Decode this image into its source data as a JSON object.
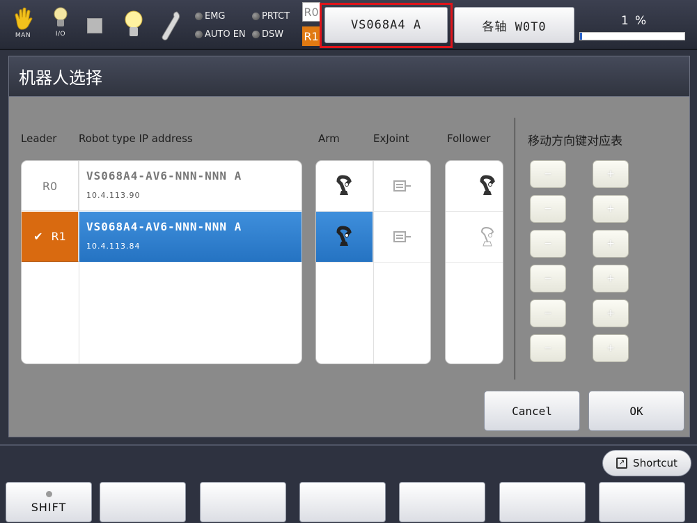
{
  "topbar": {
    "mode_label": "MAN",
    "io_label": "I/O",
    "indicators": [
      "EMG",
      "PRTCT",
      "AUTO EN",
      "DSW"
    ],
    "robot_labels": [
      "R0",
      "R1"
    ],
    "robot_button": "VS068A4 A",
    "axis_button": "各轴 W0T0",
    "speed_text": "1 %",
    "speed_percent": 1
  },
  "dialog": {
    "title": "机器人选择",
    "headers": {
      "leader": "Leader",
      "robot_type": "Robot type  IP address",
      "arm": "Arm",
      "exjoint": "ExJoint",
      "follower": "Follower",
      "mapping": "移动方向键对应表"
    },
    "robots": [
      {
        "id": "R0",
        "type": "VS068A4-AV6-NNN-NNN A",
        "ip": "10.4.113.90",
        "selected": false
      },
      {
        "id": "R1",
        "type": "VS068A4-AV6-NNN-NNN A",
        "ip": "10.4.113.84",
        "selected": true
      }
    ],
    "minus_label": "−",
    "plus_label": "+",
    "cancel": "Cancel",
    "ok": "OK"
  },
  "bottom": {
    "shortcut": "Shortcut",
    "keys": [
      "SHIFT",
      "",
      "",
      "",
      "",
      "",
      ""
    ]
  }
}
